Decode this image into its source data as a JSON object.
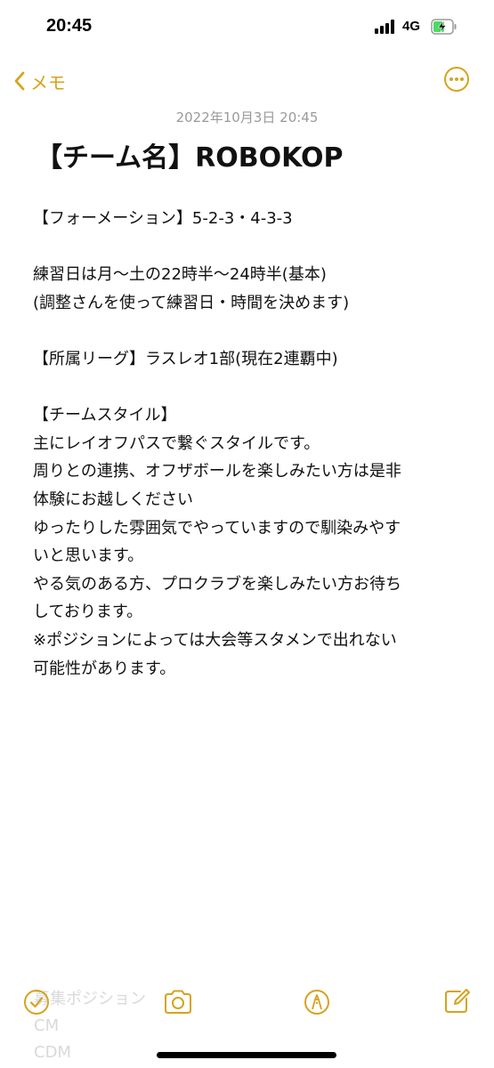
{
  "status_bar": {
    "time": "20:45",
    "network": "4G",
    "battery_icon": "battery-charging-icon",
    "signal_icon": "signal-bars-icon"
  },
  "nav": {
    "back_label": "メモ",
    "back_icon": "chevron-left-icon",
    "more_icon": "ellipsis-circle-icon"
  },
  "note": {
    "date": "2022年10月3日 20:45",
    "title": "【チーム名】ROBOKOP",
    "lines": [
      "【フォーメーション】5-2-3・4-3-3",
      "",
      "練習日は月〜土の22時半〜24時半(基本)",
      "(調整さんを使って練習日・時間を決めます)",
      "",
      "【所属リーグ】ラスレオ1部(現在2連覇中)",
      "",
      "【チームスタイル】",
      "主にレイオフパスで繋ぐスタイルです。",
      "周りとの連携、オフザボールを楽しみたい方は是非",
      "体験にお越しください",
      "ゆったりした雰囲気でやっていますので馴染みやす",
      "いと思います。",
      "やる気のある方、プロクラブを楽しみたい方お待ち",
      "しております。",
      "※ポジションによっては大会等スタメンで出れない",
      "可能性があります。"
    ]
  },
  "ghost_lines": [
    "募集ポジション",
    "CM",
    "CDM"
  ],
  "toolbar": {
    "checklist_icon": "checklist-icon",
    "camera_icon": "camera-icon",
    "markup_icon": "markup-pen-icon",
    "compose_icon": "compose-icon"
  },
  "colors": {
    "accent": "#d6a31e",
    "date_gray": "#9a9a9e",
    "battery_green": "#4cd964"
  }
}
